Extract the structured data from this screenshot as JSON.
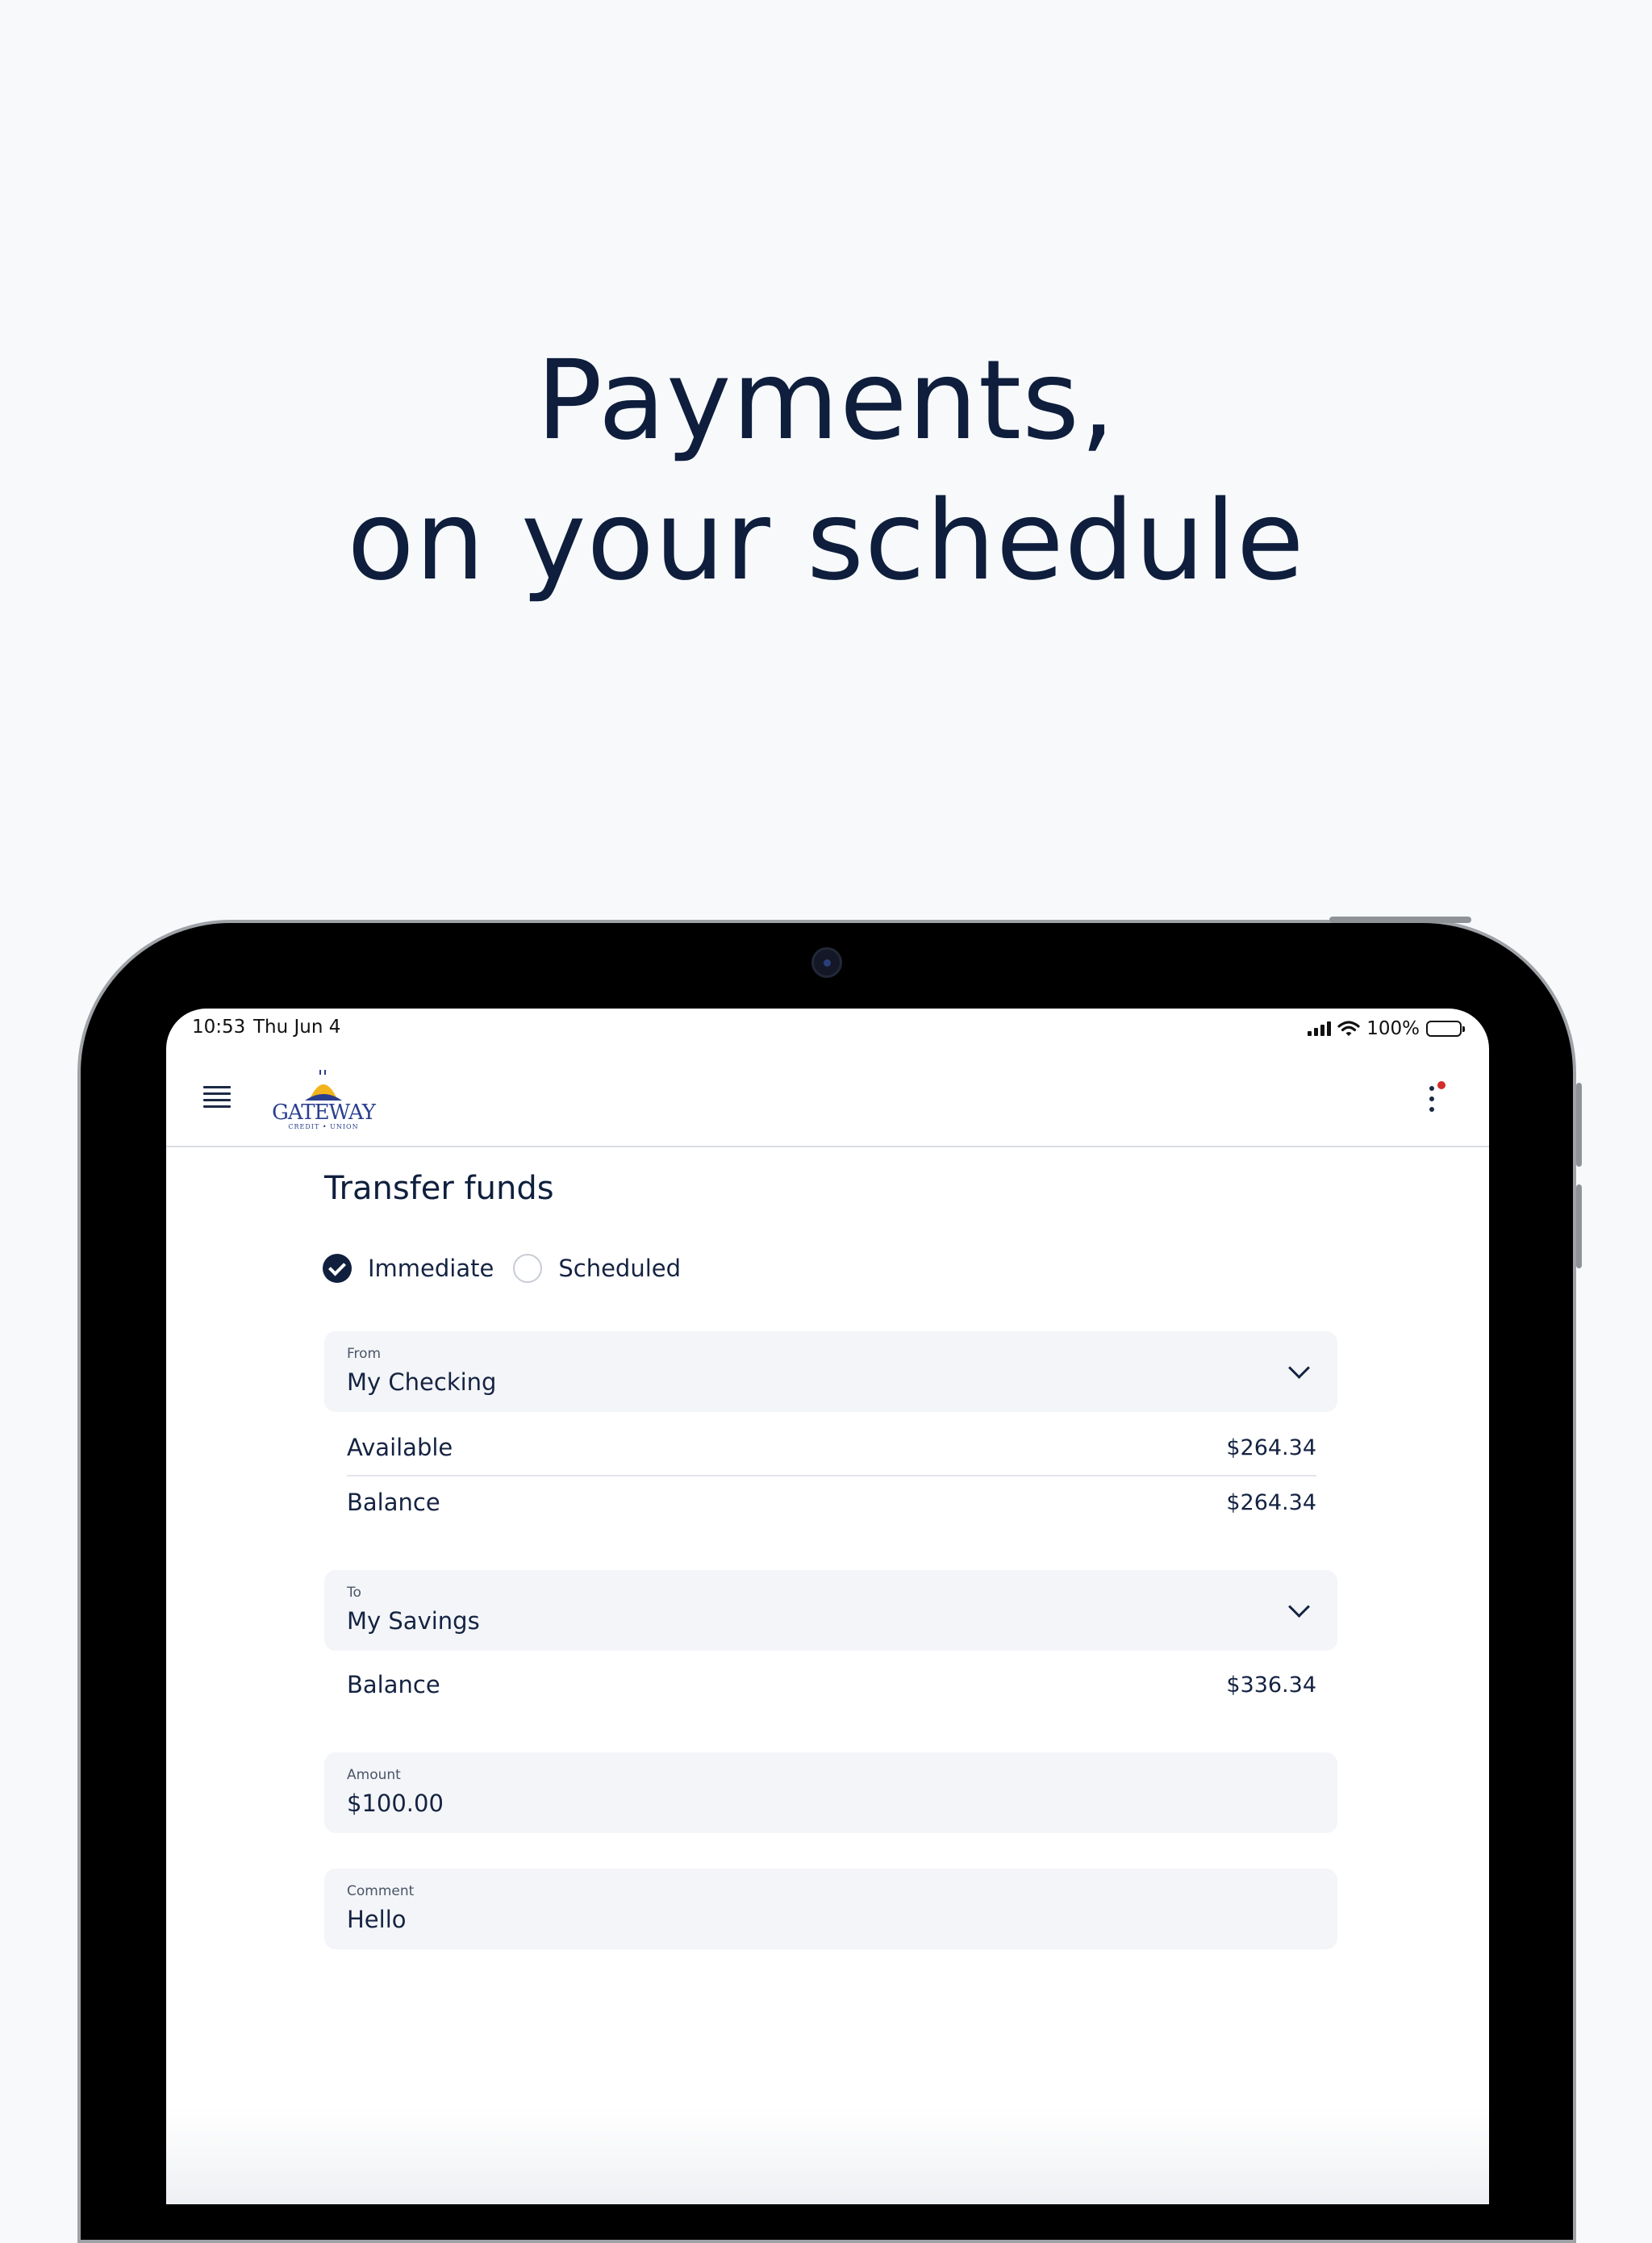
{
  "headline": {
    "line1": "Payments,",
    "line2": "on your schedule"
  },
  "status_bar": {
    "time": "10:53",
    "date": "Thu Jun 4",
    "battery": "100%"
  },
  "header": {
    "logo_text": "GATEWAY",
    "logo_subtext": "CREDIT • UNION"
  },
  "transfer": {
    "title": "Transfer funds",
    "options": [
      {
        "label": "Immediate",
        "selected": true
      },
      {
        "label": "Scheduled",
        "selected": false
      }
    ],
    "from": {
      "label": "From",
      "value": "My Checking",
      "available_label": "Available",
      "available_value": "$264.34",
      "balance_label": "Balance",
      "balance_value": "$264.34"
    },
    "to": {
      "label": "To",
      "value": "My Savings",
      "balance_label": "Balance",
      "balance_value": "$336.34"
    },
    "amount": {
      "label": "Amount",
      "value": "$100.00"
    },
    "comment": {
      "label": "Comment",
      "value": "Hello"
    }
  },
  "colors": {
    "navy": "#0f1f3d",
    "background": "#f7f9fb",
    "field_bg": "#f3f5f8",
    "notification_dot": "#d52b2b"
  }
}
